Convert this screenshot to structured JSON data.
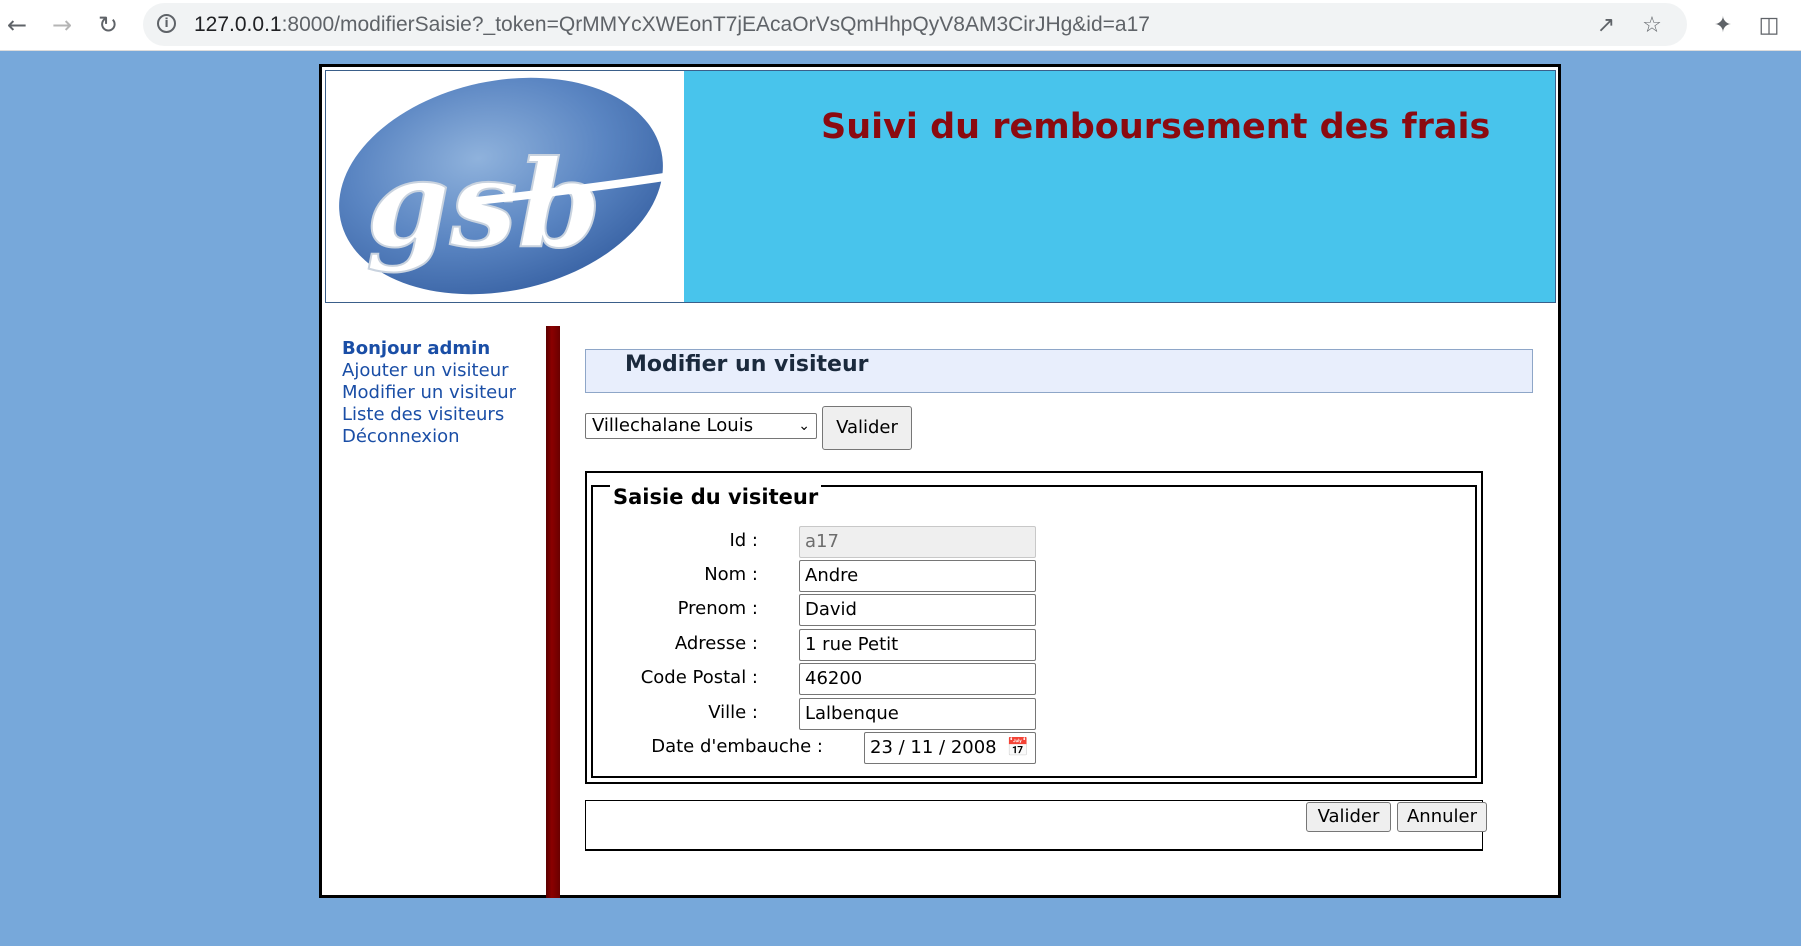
{
  "browser": {
    "url_host": "127.0.0.1",
    "url_rest": ":8000/modifierSaisie?_token=QrMMYcXWEonT7jEAcaOrVsQmHhpQyV8AM3CirJHg&id=a17",
    "icons": [
      "back-arrow-icon",
      "forward-arrow-icon",
      "reload-icon",
      "info-icon",
      "share-icon",
      "star-icon",
      "extensions-icon",
      "side-panel-icon"
    ]
  },
  "header": {
    "logo_text": "gsb",
    "title": "Suivi du remboursement des frais"
  },
  "sidebar": {
    "greeting": "Bonjour admin",
    "items": [
      {
        "label": "Ajouter un visiteur"
      },
      {
        "label": "Modifier un visiteur"
      },
      {
        "label": "Liste des visiteurs"
      },
      {
        "label": "Déconnexion"
      }
    ]
  },
  "main": {
    "title": "Modifier un visiteur",
    "visitor_select": "Villechalane Louis",
    "select_button": "Valider",
    "form": {
      "legend": "Saisie du visiteur",
      "fields": [
        {
          "label": "Id :",
          "value": "a17",
          "readonly": true
        },
        {
          "label": "Nom :",
          "value": "Andre"
        },
        {
          "label": "Prenom :",
          "value": "David"
        },
        {
          "label": "Adresse :",
          "value": "1 rue Petit"
        },
        {
          "label": "Code Postal :",
          "value": "46200"
        },
        {
          "label": "Ville :",
          "value": "Lalbenque"
        },
        {
          "label": "Date d'embauche :",
          "value": "23 / 11 / 2008"
        }
      ]
    },
    "submit_button": "Valider",
    "cancel_button": "Annuler"
  },
  "colors": {
    "page_bg": "#77a8da",
    "header_bg": "#48c4ec",
    "title_color": "#8b0a10",
    "link_color": "#1a4ea6"
  }
}
